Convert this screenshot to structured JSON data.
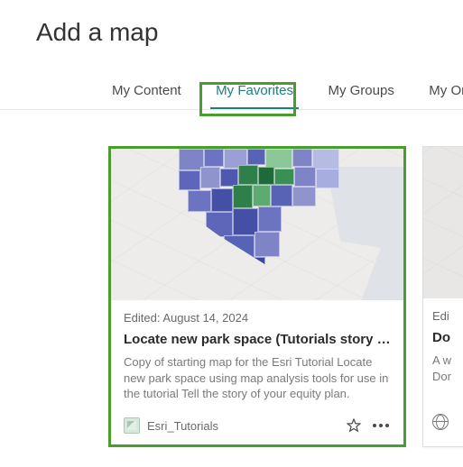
{
  "header": {
    "title": "Add a map"
  },
  "tabs": [
    {
      "label": "My Content"
    },
    {
      "label": "My Favorites"
    },
    {
      "label": "My Groups"
    },
    {
      "label": "My Organization"
    }
  ],
  "active_tab_index": 1,
  "cards": [
    {
      "edited": "Edited: August 14, 2024",
      "title": "Locate new park space (Tutorials story …",
      "desc": "Copy of starting map for the Esri Tutorial Locate new park space using map analysis tools for use in the tutorial Tell the story of your equity plan.",
      "owner": "Esri_Tutorials"
    },
    {
      "edited": "Edi",
      "title": "Do",
      "desc": "A w\nDor",
      "owner": ""
    }
  ],
  "highlight": {
    "tab_index": 1,
    "card_index": 0
  }
}
